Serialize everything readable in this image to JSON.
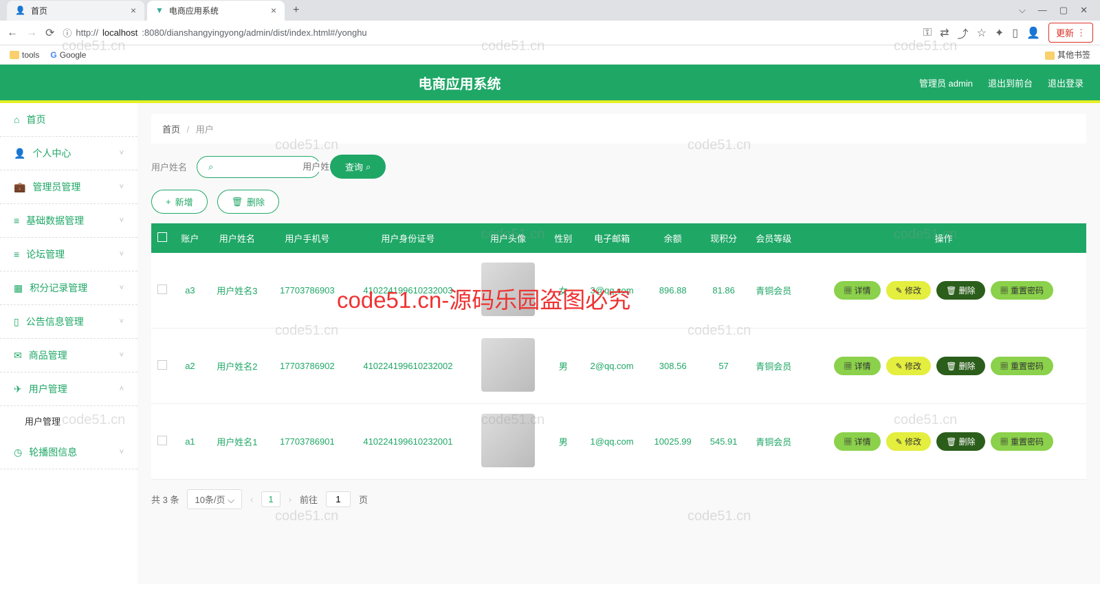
{
  "browser": {
    "tabs": [
      {
        "title": "首页",
        "active": false
      },
      {
        "title": "电商应用系统",
        "active": true
      }
    ],
    "url_prefix": "http://",
    "url_host": "localhost",
    "url_rest": ":8080/dianshangyingyong/admin/dist/index.html#/yonghu",
    "update_label": "更新",
    "bookmarks": {
      "tools": "tools",
      "google": "Google",
      "other": "其他书签"
    },
    "win": {
      "min": "—",
      "max": "▢",
      "close": "✕",
      "caret": "⌵"
    }
  },
  "header": {
    "title": "电商应用系统",
    "admin": "管理员 admin",
    "to_front": "退出到前台",
    "logout": "退出登录"
  },
  "sidebar": {
    "items": [
      {
        "label": "首页",
        "icon": "⌂",
        "expand": false
      },
      {
        "label": "个人中心",
        "icon": "👤",
        "expand": true
      },
      {
        "label": "管理员管理",
        "icon": "💼",
        "expand": true
      },
      {
        "label": "基础数据管理",
        "icon": "≡",
        "expand": true
      },
      {
        "label": "论坛管理",
        "icon": "≡",
        "expand": true
      },
      {
        "label": "积分记录管理",
        "icon": "▦",
        "expand": true
      },
      {
        "label": "公告信息管理",
        "icon": "▯",
        "expand": true
      },
      {
        "label": "商品管理",
        "icon": "✉",
        "expand": true
      },
      {
        "label": "用户管理",
        "icon": "✈",
        "expand": true,
        "open": true
      },
      {
        "label": "轮播图信息",
        "icon": "◷",
        "expand": true
      }
    ],
    "submenu": "用户管理"
  },
  "breadcrumb": {
    "home": "首页",
    "current": "用户"
  },
  "search": {
    "label": "用户姓名",
    "placeholder": "用户姓名",
    "btn": "查询"
  },
  "actions": {
    "add": "新增",
    "del": "删除"
  },
  "table": {
    "headers": [
      "",
      "账户",
      "用户姓名",
      "用户手机号",
      "用户身份证号",
      "用户头像",
      "性别",
      "电子邮箱",
      "余额",
      "现积分",
      "会员等级",
      "操作"
    ],
    "rows": [
      {
        "account": "a3",
        "name": "用户姓名3",
        "phone": "17703786903",
        "idcard": "410224199610232003",
        "gender": "女",
        "email": "3@qq.com",
        "balance": "896.88",
        "points": "81.86",
        "level": "青铜会员"
      },
      {
        "account": "a2",
        "name": "用户姓名2",
        "phone": "17703786902",
        "idcard": "410224199610232002",
        "gender": "男",
        "email": "2@qq.com",
        "balance": "308.56",
        "points": "57",
        "level": "青铜会员"
      },
      {
        "account": "a1",
        "name": "用户姓名1",
        "phone": "17703786901",
        "idcard": "410224199610232001",
        "gender": "男",
        "email": "1@qq.com",
        "balance": "10025.99",
        "points": "545.91",
        "level": "青铜会员"
      }
    ],
    "ops": {
      "detail": "详情",
      "edit": "修改",
      "del": "删除",
      "reset": "重置密码"
    }
  },
  "pagination": {
    "total": "共 3 条",
    "pagesize": "10条/页",
    "current": "1",
    "goto_pre": "前往",
    "goto_suf": "页",
    "goto_val": "1"
  },
  "watermarks": {
    "gray": "code51.cn",
    "red": "code51.cn-源码乐园盗图必究"
  }
}
